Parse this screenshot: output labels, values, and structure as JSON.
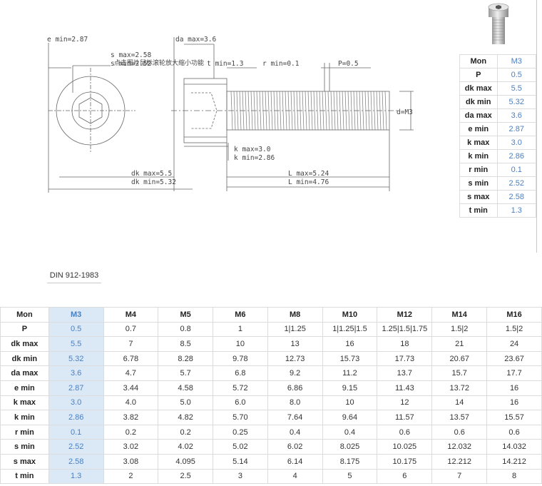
{
  "drawing": {
    "e_min": "e min=2.87",
    "s_max": "s max=2.58",
    "s_min": "s min=2.52",
    "overlay": "点击图片鼠标滚轮放大缩小功能",
    "da_max": "da max=3.6",
    "t_min": "t min=1.3",
    "r_min": "r min=0.1",
    "pitch": "P=0.5",
    "thread": "d=M3",
    "k_max": "k max=3.0",
    "k_min": "k min=2.86",
    "dk_max": "dk max=5.5",
    "dk_min": "dk min=5.32",
    "L_max": "L max=5.24",
    "L_min": "L min=4.76"
  },
  "thumb_icon": "socket-cap-screw-icon",
  "side_table": {
    "header_key": "Mon",
    "header_value": "M3",
    "rows": [
      {
        "key": "P",
        "value": "0.5"
      },
      {
        "key": "dk max",
        "value": "5.5"
      },
      {
        "key": "dk min",
        "value": "5.32"
      },
      {
        "key": "da max",
        "value": "3.6"
      },
      {
        "key": "e min",
        "value": "2.87"
      },
      {
        "key": "k max",
        "value": "3.0"
      },
      {
        "key": "k min",
        "value": "2.86"
      },
      {
        "key": "r min",
        "value": "0.1"
      },
      {
        "key": "s min",
        "value": "2.52"
      },
      {
        "key": "s max",
        "value": "2.58"
      },
      {
        "key": "t min",
        "value": "1.3"
      }
    ]
  },
  "standard": "DIN 912-1983",
  "main_table": {
    "header": [
      "Mon",
      "M3",
      "M4",
      "M5",
      "M6",
      "M8",
      "M10",
      "M12",
      "M14",
      "M16"
    ],
    "rows": [
      [
        "P",
        "0.5",
        "0.7",
        "0.8",
        "1",
        "1|1.25",
        "1|1.25|1.5",
        "1.25|1.5|1.75",
        "1.5|2",
        "1.5|2"
      ],
      [
        "dk max",
        "5.5",
        "7",
        "8.5",
        "10",
        "13",
        "16",
        "18",
        "21",
        "24"
      ],
      [
        "dk min",
        "5.32",
        "6.78",
        "8.28",
        "9.78",
        "12.73",
        "15.73",
        "17.73",
        "20.67",
        "23.67"
      ],
      [
        "da max",
        "3.6",
        "4.7",
        "5.7",
        "6.8",
        "9.2",
        "11.2",
        "13.7",
        "15.7",
        "17.7"
      ],
      [
        "e min",
        "2.87",
        "3.44",
        "4.58",
        "5.72",
        "6.86",
        "9.15",
        "11.43",
        "13.72",
        "16"
      ],
      [
        "k max",
        "3.0",
        "4.0",
        "5.0",
        "6.0",
        "8.0",
        "10",
        "12",
        "14",
        "16"
      ],
      [
        "k min",
        "2.86",
        "3.82",
        "4.82",
        "5.70",
        "7.64",
        "9.64",
        "11.57",
        "13.57",
        "15.57"
      ],
      [
        "r min",
        "0.1",
        "0.2",
        "0.2",
        "0.25",
        "0.4",
        "0.4",
        "0.6",
        "0.6",
        "0.6"
      ],
      [
        "s min",
        "2.52",
        "3.02",
        "4.02",
        "5.02",
        "6.02",
        "8.025",
        "10.025",
        "12.032",
        "14.032"
      ],
      [
        "s max",
        "2.58",
        "3.08",
        "4.095",
        "5.14",
        "6.14",
        "8.175",
        "10.175",
        "12.212",
        "14.212"
      ],
      [
        "t min",
        "1.3",
        "2",
        "2.5",
        "3",
        "4",
        "5",
        "6",
        "7",
        "8"
      ]
    ]
  }
}
